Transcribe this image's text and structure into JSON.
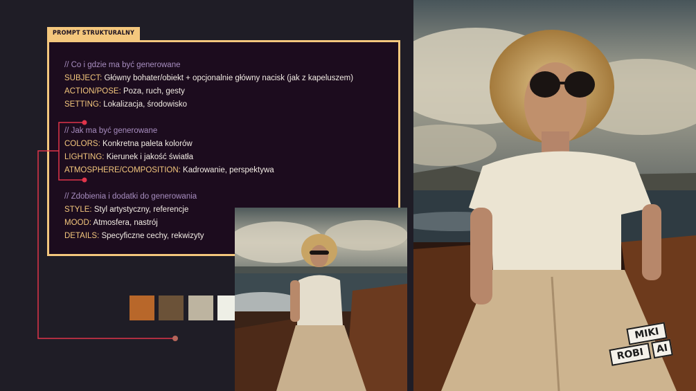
{
  "card": {
    "tag": "PROMPT STRUKTURALNY",
    "sections": [
      {
        "comment": "// Co i gdzie ma być generowane",
        "lines": [
          {
            "key": "SUBJECT:",
            "text": " Główny bohater/obiekt + opcjonalnie główny nacisk (jak z kapeluszem)"
          },
          {
            "key": "ACTION/POSE:",
            "text": " Poza, ruch, gesty"
          },
          {
            "key": "SETTING:",
            "text": " Lokalizacja, środowisko"
          }
        ]
      },
      {
        "comment": "// Jak ma być generowane",
        "lines": [
          {
            "key": "COLORS:",
            "text": " Konkretna paleta kolorów"
          },
          {
            "key": "LIGHTING:",
            "text": " Kierunek i jakość światła"
          },
          {
            "key": "ATMOSPHERE/COMPOSITION:",
            "text": " Kadrowanie, perspektywa"
          }
        ]
      },
      {
        "comment": "// Zdobienia i dodatki do generowania",
        "lines": [
          {
            "key": "STYLE:",
            "text": " Styl artystyczny, referencje"
          },
          {
            "key": "MOOD:",
            "text": " Atmosfera, nastrój"
          },
          {
            "key": "DETAILS:",
            "text": " Specyficzne cechy, rekwizyty"
          }
        ]
      }
    ]
  },
  "palette": [
    "#b8672a",
    "#6b5238",
    "#bdb4a0",
    "#eeefe6"
  ],
  "colors": {
    "accent": "#f4c77d",
    "card_bg": "#1c0c1e",
    "comment": "#a88ec0",
    "connector": "#e0344a",
    "background": "#1f1d26"
  },
  "logo": {
    "word1": "MIKI",
    "word2": "ROBI",
    "word3": "AI"
  }
}
